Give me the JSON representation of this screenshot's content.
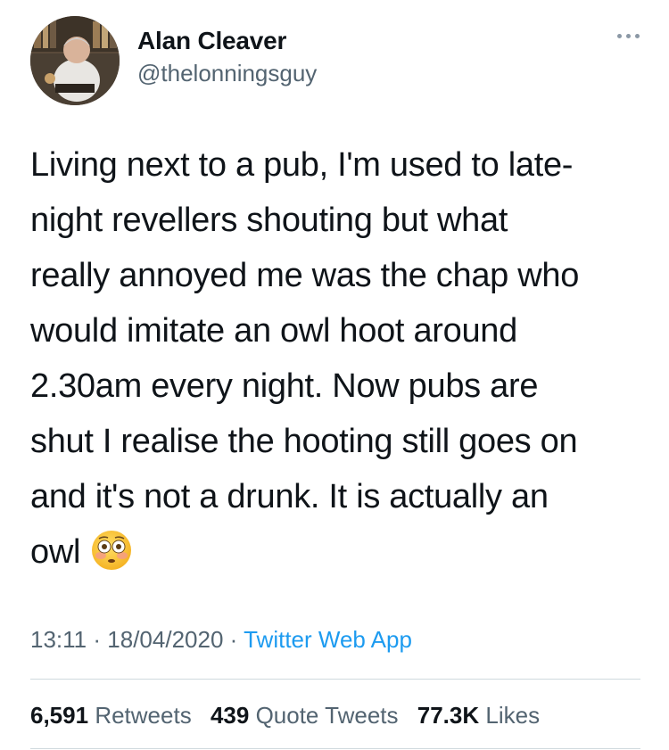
{
  "author": {
    "name": "Alan Cleaver",
    "handle": "@thelonningsguy",
    "avatar_icon": "profile-photo"
  },
  "tweet": {
    "lines": [
      "Living next to a pub, I'm used to late-",
      "night revellers shouting but what",
      "really annoyed me was the chap who",
      "would imitate an owl hoot around",
      "2.30am every night. Now pubs are",
      "shut I realise the hooting still goes on",
      "and it's not a drunk. It is actually an",
      "owl"
    ],
    "emoji": "flushed-face-emoji"
  },
  "meta": {
    "time": "13:11",
    "date": "18/04/2020",
    "separator": "·",
    "source": "Twitter Web App"
  },
  "stats": {
    "retweets_count": "6,591",
    "retweets_label": "Retweets",
    "quotes_count": "439",
    "quotes_label": "Quote Tweets",
    "likes_count": "77.3K",
    "likes_label": "Likes"
  },
  "colors": {
    "text": "#0f1419",
    "secondary": "#536471",
    "link": "#1d9bf0",
    "divider": "#cfd9de"
  }
}
